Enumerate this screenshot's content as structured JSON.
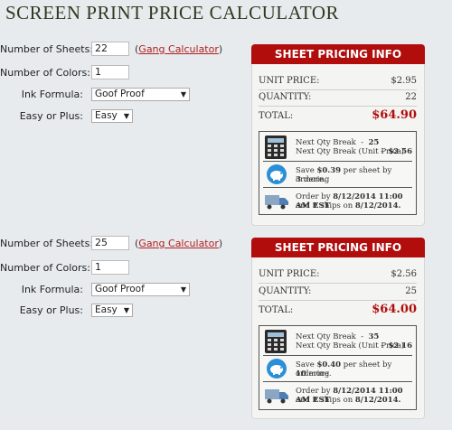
{
  "page": {
    "title": "SCREEN PRINT PRICE CALCULATOR"
  },
  "calculators": [
    {
      "form": {
        "sheets_label": "Number of Sheets:",
        "sheets_value": "22",
        "gang_link": "Gang Calculator",
        "colors_label": "Number of Colors:",
        "colors_value": "1",
        "ink_label": "Ink Formula:",
        "ink_value": "Goof Proof",
        "easy_label": "Easy or Plus:",
        "easy_value": "Easy"
      },
      "panel": {
        "header": "SHEET PRICING INFO",
        "unit_price_label": "UNIT PRICE:",
        "unit_price": "$2.95",
        "quantity_label": "QUANTITY:",
        "quantity": "22",
        "total_label": "TOTAL:",
        "total": "$64.90",
        "next_qty_break_label": "Next Qty Break",
        "next_qty_break_value": "25",
        "next_qty_unit_label": "Next Qty Break (Unit Price)",
        "next_qty_unit_value": "$2.56",
        "save_pre": "Save",
        "save_amount": "$0.39",
        "save_mid": "per sheet by ordering",
        "save_more_count": "3",
        "save_more_word": "more.",
        "order_pre": "Order by",
        "order_by": "8/12/2014 11:00 AM EST",
        "ships_pre": "and it ships on",
        "ships_on": "8/12/2014."
      }
    },
    {
      "form": {
        "sheets_label": "Number of Sheets:",
        "sheets_value": "25",
        "gang_link": "Gang Calculator",
        "colors_label": "Number of Colors:",
        "colors_value": "1",
        "ink_label": "Ink Formula:",
        "ink_value": "Goof Proof",
        "easy_label": "Easy or Plus:",
        "easy_value": "Easy"
      },
      "panel": {
        "header": "SHEET PRICING INFO",
        "unit_price_label": "UNIT PRICE:",
        "unit_price": "$2.56",
        "quantity_label": "QUANTITY:",
        "quantity": "25",
        "total_label": "TOTAL:",
        "total": "$64.00",
        "next_qty_break_label": "Next Qty Break",
        "next_qty_break_value": "35",
        "next_qty_unit_label": "Next Qty Break (Unit Price)",
        "next_qty_unit_value": "$2.16",
        "save_pre": "Save",
        "save_amount": "$0.40",
        "save_mid": "per sheet by ordering",
        "save_more_count": "10",
        "save_more_word": "more.",
        "order_pre": "Order by",
        "order_by": "8/12/2014 11:00 AM EST",
        "ships_pre": "and it ships on",
        "ships_on": "8/12/2014."
      }
    }
  ],
  "colors": {
    "accent_red": "#b10d0d",
    "title_green": "#2f3a22",
    "background": "#e8ebee"
  },
  "icons": [
    "calculator-icon",
    "piggy-bank-icon",
    "delivery-truck-icon",
    "chevron-down-icon"
  ]
}
